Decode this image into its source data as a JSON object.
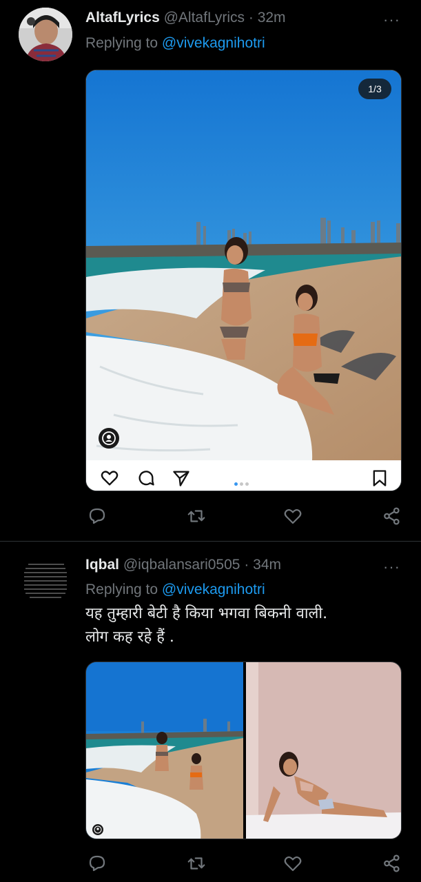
{
  "tweets": [
    {
      "name": "AltafLyrics",
      "handle": "@AltafLyrics",
      "separator": "·",
      "time": "32m",
      "replying_prefix": "Replying to ",
      "replying_to": "@vivekagnihotri",
      "media": {
        "counter": "1/3",
        "carousel_pages": 3,
        "carousel_current": 1
      }
    },
    {
      "name": "Iqbal",
      "handle": "@iqbalansari0505",
      "separator": "·",
      "time": "34m",
      "replying_prefix": "Replying to ",
      "replying_to": "@vivekagnihotri",
      "text": "यह तुम्हारी बेटी है किया भगवा बिकनी वाली.\nलोग कह रहे हैं ."
    }
  ],
  "icons": {
    "reply": "reply-icon",
    "retweet": "retweet-icon",
    "like": "heart-icon",
    "share": "share-icon",
    "more": "more-icon"
  },
  "colors": {
    "background": "#000000",
    "text": "#e7e9ea",
    "secondary": "#71767b",
    "link": "#1d9bf0",
    "divider": "#2f3336"
  },
  "more_glyph": "···"
}
